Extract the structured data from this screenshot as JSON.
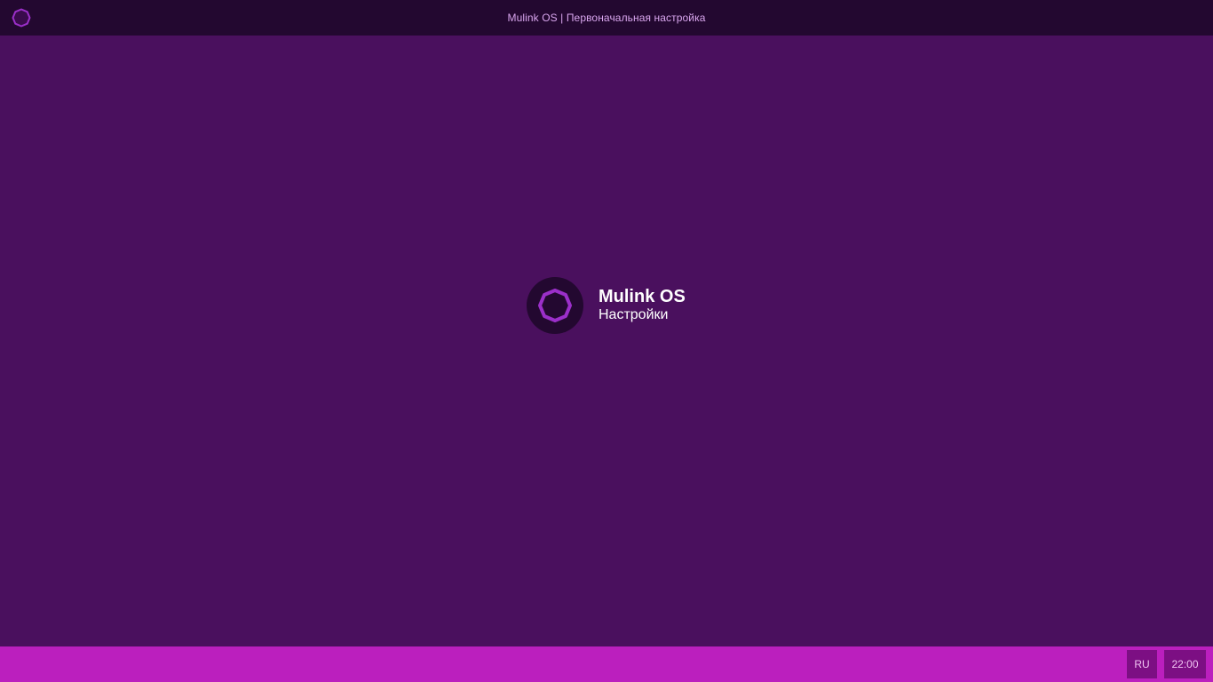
{
  "topbar": {
    "title": "Mulink OS | Первоначальная настройка",
    "logo_icon": "octagon-logo-icon"
  },
  "splash": {
    "logo_icon": "octagon-logo-icon",
    "name": "Mulink OS",
    "subtitle": "Настройки"
  },
  "taskbar": {
    "language": "RU",
    "clock": "22:00"
  },
  "colors": {
    "topbar_bg": "#230830",
    "desktop_bg": "#4a105e",
    "taskbar_bg": "#bb1fbe",
    "tray_button_bg": "#7c0f83",
    "logo_accent": "#9b2fc9",
    "logo_dark": "#230830"
  }
}
